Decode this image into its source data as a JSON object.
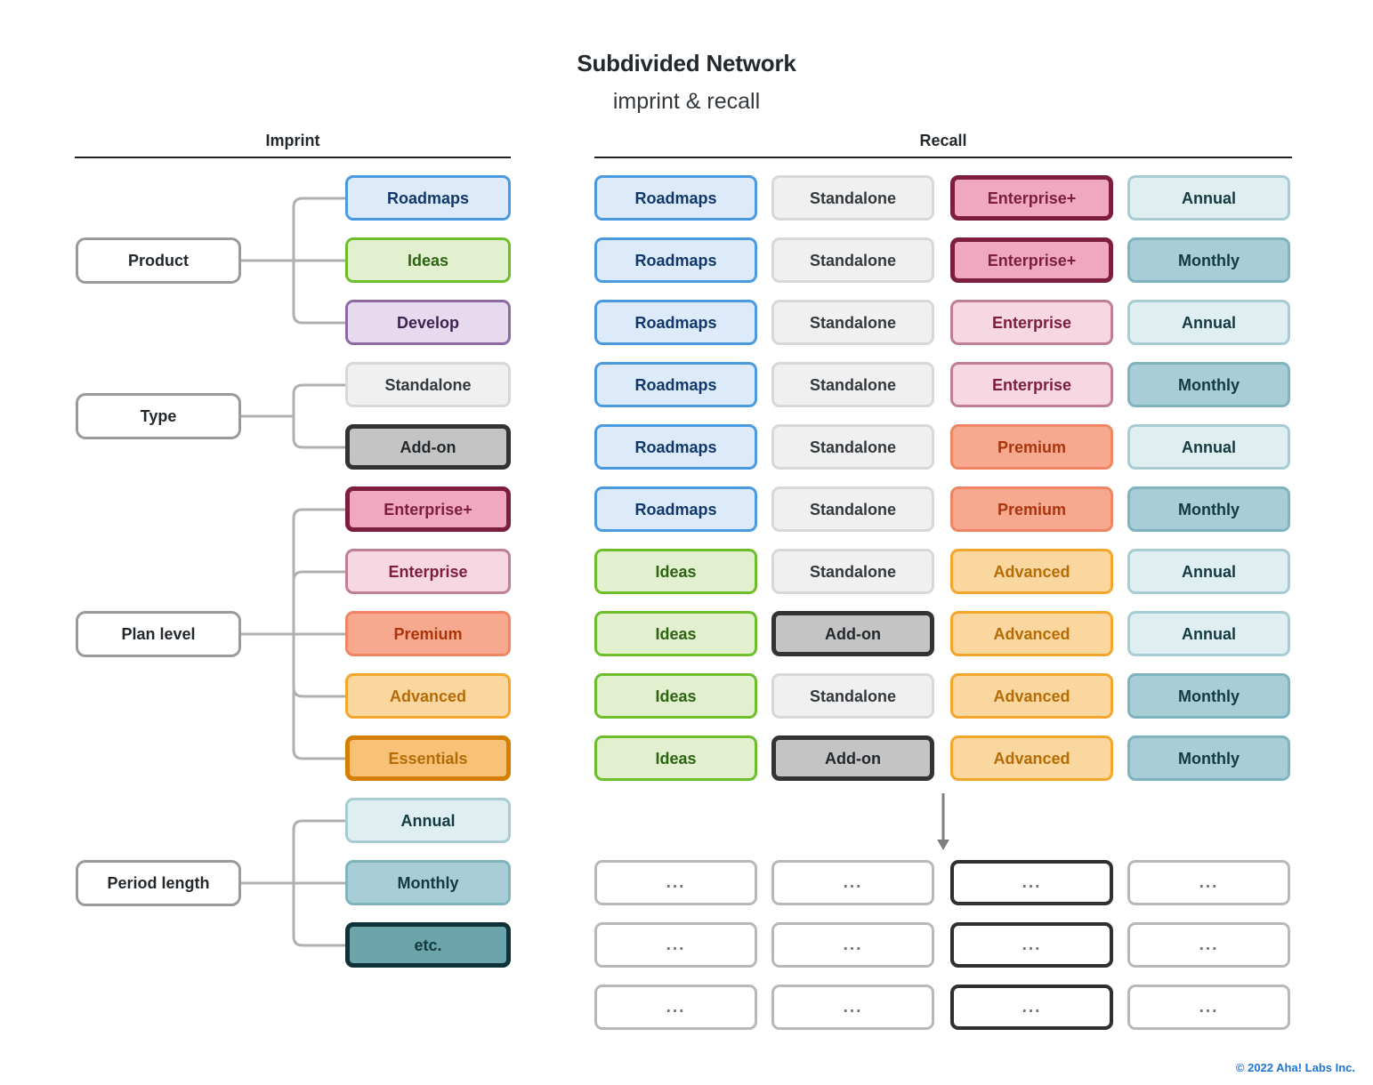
{
  "header": {
    "title": "Subdivided Network",
    "subtitle": "imprint & recall"
  },
  "columns": {
    "imprint_label": "Imprint",
    "recall_label": "Recall"
  },
  "palette": {
    "roadmaps": {
      "fill": "#dceafa",
      "border": "#4a9ae0",
      "text": "#12386b"
    },
    "ideas": {
      "fill": "#e2f0d0",
      "border": "#6cbe2a",
      "text": "#2d6412"
    },
    "develop": {
      "fill": "#e7daee",
      "border": "#8e6aa5",
      "text": "#3d2251"
    },
    "standalone": {
      "fill": "#f0f0f0",
      "border": "#d8d8d8",
      "text": "#33383c"
    },
    "addon": {
      "fill": "#c4c4c4",
      "border": "#333333",
      "text": "#23282c"
    },
    "enterprise_plus": {
      "fill": "#efa8c0",
      "border": "#7d1e3c",
      "text": "#7d1e3c"
    },
    "enterprise": {
      "fill": "#f7d7e2",
      "border": "#c07e98",
      "text": "#7d1e3c"
    },
    "premium": {
      "fill": "#f7a98f",
      "border": "#f08463",
      "text": "#a8350c"
    },
    "advanced": {
      "fill": "#fbd7a0",
      "border": "#f4a62a",
      "text": "#b56c06"
    },
    "essentials": {
      "fill": "#f8c178",
      "border": "#d47f00",
      "text": "#b56c06"
    },
    "annual": {
      "fill": "#dfeef1",
      "border": "#a8ccd4",
      "text": "#123a40"
    },
    "monthly": {
      "fill": "#a8cdd6",
      "border": "#7fb4bf",
      "text": "#123a40"
    },
    "etc": {
      "fill": "#6ba4aa",
      "border": "#0f3138",
      "text": "#123a40"
    },
    "parent": {
      "fill": "#ffffff",
      "border": "#9a9a9a",
      "text": "#23282c"
    },
    "placeholder": {
      "fill": "#ffffff",
      "border": "#b8b8b8",
      "text": "#6d7278"
    },
    "placeholder_emphasis": {
      "fill": "#ffffff",
      "border": "#2f3032",
      "text": "#6d7278"
    },
    "connector": "#b0b0b0",
    "arrow": "#808080",
    "footer_link": "#1f73d2"
  },
  "imprint": {
    "groups": [
      {
        "parent": "Product",
        "children": [
          {
            "label": "Roadmaps",
            "style": "roadmaps",
            "weight": "thin"
          },
          {
            "label": "Ideas",
            "style": "ideas",
            "weight": "thin"
          },
          {
            "label": "Develop",
            "style": "develop",
            "weight": "thin"
          }
        ]
      },
      {
        "parent": "Type",
        "children": [
          {
            "label": "Standalone",
            "style": "standalone",
            "weight": "thin"
          },
          {
            "label": "Add-on",
            "style": "addon",
            "weight": "thick"
          }
        ]
      },
      {
        "parent": "Plan level",
        "children": [
          {
            "label": "Enterprise+",
            "style": "enterprise_plus",
            "weight": "thick"
          },
          {
            "label": "Enterprise",
            "style": "enterprise",
            "weight": "thin"
          },
          {
            "label": "Premium",
            "style": "premium",
            "weight": "thin"
          },
          {
            "label": "Advanced",
            "style": "advanced",
            "weight": "thin"
          },
          {
            "label": "Essentials",
            "style": "essentials",
            "weight": "thick"
          }
        ]
      },
      {
        "parent": "Period length",
        "children": [
          {
            "label": "Annual",
            "style": "annual",
            "weight": "thin"
          },
          {
            "label": "Monthly",
            "style": "monthly",
            "weight": "thin"
          },
          {
            "label": "etc.",
            "style": "etc",
            "weight": "thick"
          }
        ]
      }
    ]
  },
  "recall": {
    "rows": [
      [
        {
          "label": "Roadmaps",
          "style": "roadmaps",
          "weight": "thin"
        },
        {
          "label": "Standalone",
          "style": "standalone",
          "weight": "thin"
        },
        {
          "label": "Enterprise+",
          "style": "enterprise_plus",
          "weight": "thick"
        },
        {
          "label": "Annual",
          "style": "annual",
          "weight": "thin"
        }
      ],
      [
        {
          "label": "Roadmaps",
          "style": "roadmaps",
          "weight": "thin"
        },
        {
          "label": "Standalone",
          "style": "standalone",
          "weight": "thin"
        },
        {
          "label": "Enterprise+",
          "style": "enterprise_plus",
          "weight": "thick"
        },
        {
          "label": "Monthly",
          "style": "monthly",
          "weight": "thin"
        }
      ],
      [
        {
          "label": "Roadmaps",
          "style": "roadmaps",
          "weight": "thin"
        },
        {
          "label": "Standalone",
          "style": "standalone",
          "weight": "thin"
        },
        {
          "label": "Enterprise",
          "style": "enterprise",
          "weight": "thin"
        },
        {
          "label": "Annual",
          "style": "annual",
          "weight": "thin"
        }
      ],
      [
        {
          "label": "Roadmaps",
          "style": "roadmaps",
          "weight": "thin"
        },
        {
          "label": "Standalone",
          "style": "standalone",
          "weight": "thin"
        },
        {
          "label": "Enterprise",
          "style": "enterprise",
          "weight": "thin"
        },
        {
          "label": "Monthly",
          "style": "monthly",
          "weight": "thin"
        }
      ],
      [
        {
          "label": "Roadmaps",
          "style": "roadmaps",
          "weight": "thin"
        },
        {
          "label": "Standalone",
          "style": "standalone",
          "weight": "thin"
        },
        {
          "label": "Premium",
          "style": "premium",
          "weight": "thin"
        },
        {
          "label": "Annual",
          "style": "annual",
          "weight": "thin"
        }
      ],
      [
        {
          "label": "Roadmaps",
          "style": "roadmaps",
          "weight": "thin"
        },
        {
          "label": "Standalone",
          "style": "standalone",
          "weight": "thin"
        },
        {
          "label": "Premium",
          "style": "premium",
          "weight": "thin"
        },
        {
          "label": "Monthly",
          "style": "monthly",
          "weight": "thin"
        }
      ],
      [
        {
          "label": "Ideas",
          "style": "ideas",
          "weight": "thin"
        },
        {
          "label": "Standalone",
          "style": "standalone",
          "weight": "thin"
        },
        {
          "label": "Advanced",
          "style": "advanced",
          "weight": "thin"
        },
        {
          "label": "Annual",
          "style": "annual",
          "weight": "thin"
        }
      ],
      [
        {
          "label": "Ideas",
          "style": "ideas",
          "weight": "thin"
        },
        {
          "label": "Add-on",
          "style": "addon",
          "weight": "thick"
        },
        {
          "label": "Advanced",
          "style": "advanced",
          "weight": "thin"
        },
        {
          "label": "Annual",
          "style": "annual",
          "weight": "thin"
        }
      ],
      [
        {
          "label": "Ideas",
          "style": "ideas",
          "weight": "thin"
        },
        {
          "label": "Standalone",
          "style": "standalone",
          "weight": "thin"
        },
        {
          "label": "Advanced",
          "style": "advanced",
          "weight": "thin"
        },
        {
          "label": "Monthly",
          "style": "monthly",
          "weight": "thin"
        }
      ],
      [
        {
          "label": "Ideas",
          "style": "ideas",
          "weight": "thin"
        },
        {
          "label": "Add-on",
          "style": "addon",
          "weight": "thick"
        },
        {
          "label": "Advanced",
          "style": "advanced",
          "weight": "thin"
        },
        {
          "label": "Monthly",
          "style": "monthly",
          "weight": "thin"
        }
      ]
    ],
    "placeholder_label": "...",
    "placeholder_rows": 3,
    "placeholder_emphasis_column": 2
  },
  "footer": {
    "copyright": "© 2022 Aha! Labs Inc."
  }
}
